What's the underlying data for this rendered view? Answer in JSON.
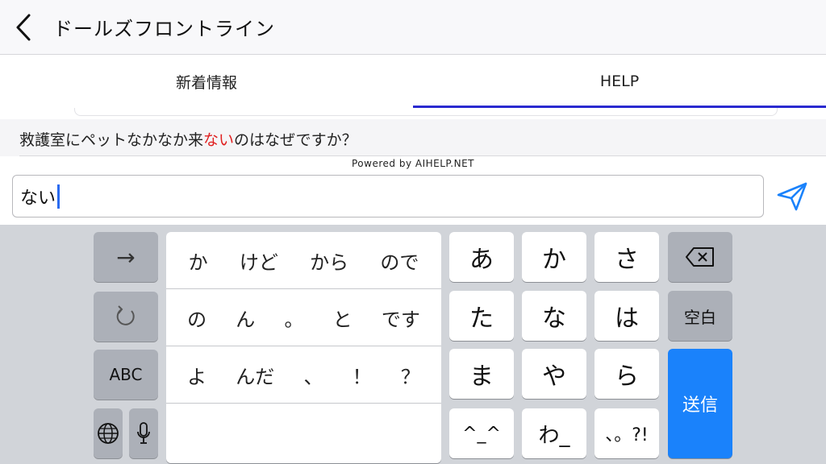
{
  "header": {
    "title": "ドールズフロントライン",
    "back_icon": "chevron-left-icon"
  },
  "tabs": [
    {
      "label": "新着情報",
      "active": false
    },
    {
      "label": "HELP",
      "active": true
    }
  ],
  "suggestion": {
    "prefix": "救護室にペットなかなか来",
    "highlight": "ない",
    "suffix": "のはなぜですか？"
  },
  "powered_by": "Powered by AIHELP.NET",
  "input": {
    "value": "ない"
  },
  "send_icon": "paper-plane-icon",
  "keyboard": {
    "left_keys": {
      "arrow": "→",
      "undo_icon": "undo-icon",
      "abc": "ABC",
      "globe_icon": "globe-icon",
      "mic_icon": "microphone-icon"
    },
    "candidates": [
      [
        "か",
        "けど",
        "から",
        "ので"
      ],
      [
        "の",
        "ん",
        "。",
        "と",
        "です"
      ],
      [
        "よ",
        "んだ",
        "、",
        "！",
        "？"
      ]
    ],
    "kana": [
      "あ",
      "か",
      "さ",
      "た",
      "な",
      "は",
      "ま",
      "や",
      "ら",
      "^_^",
      "わ_",
      "、。?!"
    ],
    "right_keys": {
      "delete_icon": "backspace-icon",
      "space": "空白",
      "send": "送信"
    }
  },
  "colors": {
    "accent": "#2a2ad0",
    "highlight": "#e02020",
    "send_key": "#1a82fb",
    "keyboard_bg": "#d1d4d9"
  }
}
